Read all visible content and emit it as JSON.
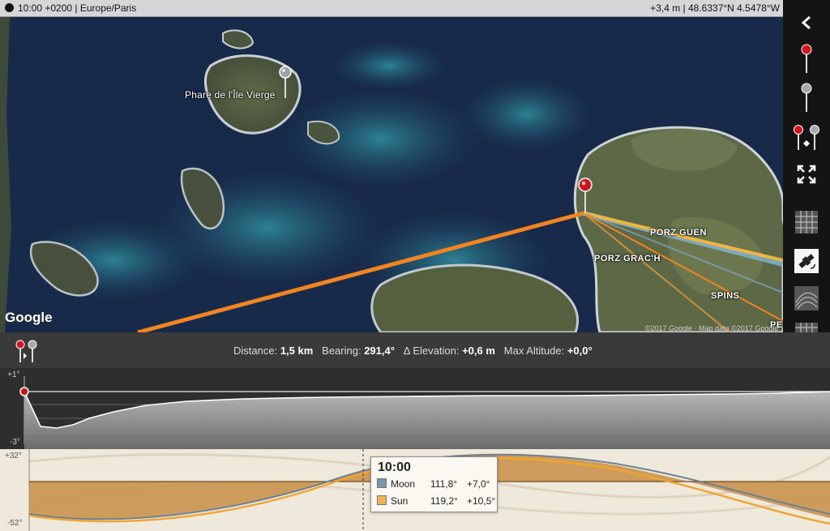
{
  "status": {
    "time": "10:00 +0200 | Europe/Paris",
    "location": "+3,4 m | 48.6337°N 4.5478°W"
  },
  "map": {
    "labels": {
      "lighthouse": "Phare de l'Île Vierge",
      "porz_guen": "PORZ GUEN",
      "porz_grach": "PORZ GRAC'H",
      "spins": "SPINS",
      "pen": "PEN"
    },
    "google": "Google",
    "copyright": "©2017 Google · Map data ©2017 Google"
  },
  "toolbar": {
    "items": [
      "back",
      "primary-pin",
      "secondary-pin",
      "swap-pins",
      "fullscreen",
      "map-type",
      "satellite",
      "terrain",
      "more"
    ]
  },
  "info": {
    "distance_label": "Distance:",
    "distance": "1,5 km",
    "bearing_label": "Bearing:",
    "bearing": "291,4°",
    "elevation_label": "Δ Elevation:",
    "elevation": "+0,6 m",
    "max_alt_label": "Max Altitude:",
    "max_alt": "+0,0°"
  },
  "profile": {
    "ymax": "+1°",
    "ymin": "-3°"
  },
  "sun_moon": {
    "ymax": "+32°",
    "ymin": "-52°",
    "tooltip": {
      "time": "10:00",
      "rows": [
        {
          "name": "Moon",
          "azimuth": "111,8°",
          "elevation": "+7,0°",
          "color": "#7f94ad"
        },
        {
          "name": "Sun",
          "azimuth": "119,2°",
          "elevation": "+10,5°",
          "color": "#f0b356"
        }
      ]
    }
  }
}
